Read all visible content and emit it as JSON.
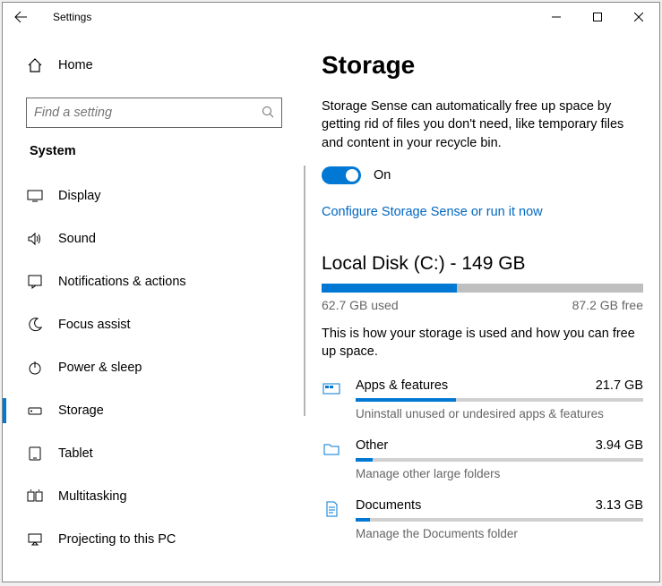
{
  "window": {
    "title": "Settings"
  },
  "sidebar": {
    "home": "Home",
    "search_placeholder": "Find a setting",
    "category": "System",
    "items": [
      {
        "label": "Display"
      },
      {
        "label": "Sound"
      },
      {
        "label": "Notifications & actions"
      },
      {
        "label": "Focus assist"
      },
      {
        "label": "Power & sleep"
      },
      {
        "label": "Storage"
      },
      {
        "label": "Tablet"
      },
      {
        "label": "Multitasking"
      },
      {
        "label": "Projecting to this PC"
      }
    ]
  },
  "main": {
    "title": "Storage",
    "sense_desc": "Storage Sense can automatically free up space by getting rid of files you don't need, like temporary files and content in your recycle bin.",
    "toggle_state": "On",
    "configure_link": "Configure Storage Sense or run it now",
    "disk": {
      "heading": "Local Disk (C:) - 149 GB",
      "used_label": "62.7 GB used",
      "free_label": "87.2 GB free",
      "used_pct": 42
    },
    "usage_desc": "This is how your storage is used and how you can free up space.",
    "categories": [
      {
        "name": "Apps & features",
        "size": "21.7 GB",
        "sub": "Uninstall unused or undesired apps & features",
        "pct": 35
      },
      {
        "name": "Other",
        "size": "3.94 GB",
        "sub": "Manage other large folders",
        "pct": 6
      },
      {
        "name": "Documents",
        "size": "3.13 GB",
        "sub": "Manage the Documents folder",
        "pct": 5
      }
    ]
  }
}
